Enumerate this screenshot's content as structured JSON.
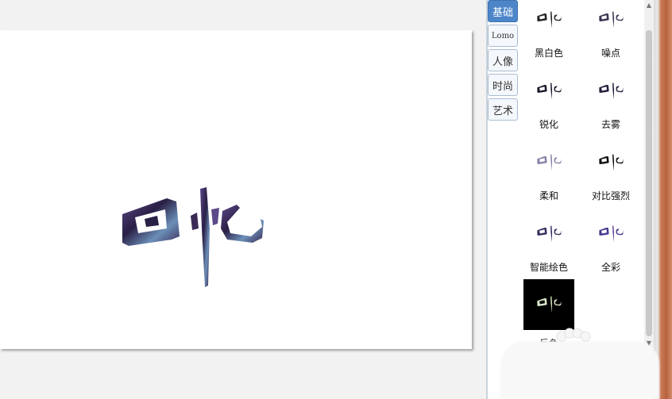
{
  "canvas": {
    "artwork_text": "回忆"
  },
  "tabs": [
    {
      "label": "基础",
      "active": true
    },
    {
      "label": "Lomo",
      "active": false
    },
    {
      "label": "人像",
      "active": false
    },
    {
      "label": "时尚",
      "active": false
    },
    {
      "label": "艺术",
      "active": false
    }
  ],
  "filters": [
    {
      "label": "黑白色",
      "thumb_text": "回忆"
    },
    {
      "label": "噪点",
      "thumb_text": "回忆"
    },
    {
      "label": "锐化",
      "thumb_text": "回忆"
    },
    {
      "label": "去雾",
      "thumb_text": "回忆"
    },
    {
      "label": "柔和",
      "thumb_text": "回忆"
    },
    {
      "label": "对比强烈",
      "thumb_text": "回忆"
    },
    {
      "label": "智能绘色",
      "thumb_text": "回忆"
    },
    {
      "label": "全彩",
      "thumb_text": "回忆"
    },
    {
      "label": "反色",
      "thumb_text": "回忆"
    }
  ],
  "colors": {
    "tab_active": "#4d86c8",
    "artwork_fill": "#3b2a5a"
  }
}
